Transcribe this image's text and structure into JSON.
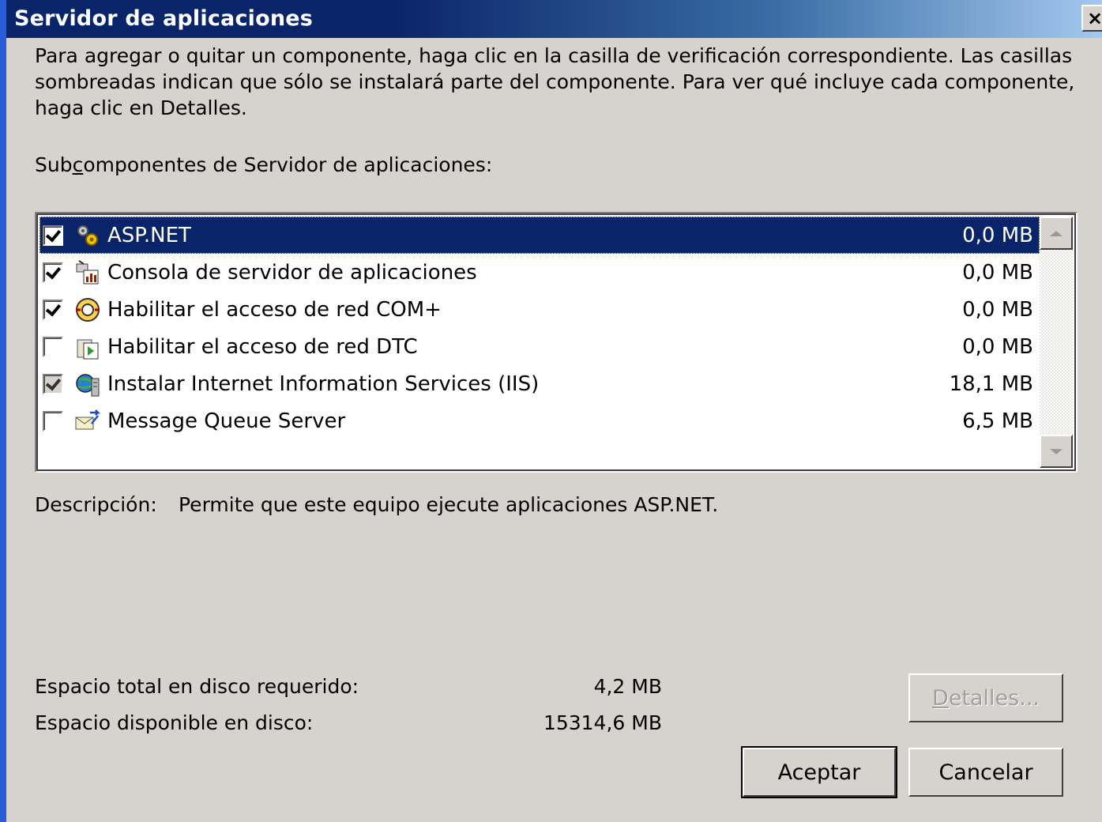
{
  "window": {
    "title": "Servidor de aplicaciones",
    "close_label": "×"
  },
  "intro_text": "Para agregar o quitar un componente, haga clic en la casilla de verificación correspondiente. Las casillas sombreadas indican que sólo se instalará parte del componente. Para ver qué incluye cada componente, haga clic en Detalles.",
  "subcomponents_label": {
    "before": "Sub",
    "accel": "c",
    "after": "omponentes de Servidor de aplicaciones:"
  },
  "components": [
    {
      "name": "ASP.NET",
      "size": "0,0 MB",
      "checked": true,
      "partial": false,
      "selected": true,
      "icon": "gears-icon"
    },
    {
      "name": "Consola de servidor de aplicaciones",
      "size": "0,0 MB",
      "checked": true,
      "partial": false,
      "selected": false,
      "icon": "console-icon"
    },
    {
      "name": "Habilitar el acceso de red COM+",
      "size": "0,0 MB",
      "checked": true,
      "partial": false,
      "selected": false,
      "icon": "com-network-icon"
    },
    {
      "name": "Habilitar el acceso de red DTC",
      "size": "0,0 MB",
      "checked": false,
      "partial": false,
      "selected": false,
      "icon": "dtc-icon"
    },
    {
      "name": "Instalar Internet Information Services (IIS)",
      "size": "18,1 MB",
      "checked": true,
      "partial": true,
      "selected": false,
      "icon": "iis-icon"
    },
    {
      "name": "Message Queue Server",
      "size": "6,5 MB",
      "checked": false,
      "partial": false,
      "selected": false,
      "icon": "message-queue-icon"
    }
  ],
  "description": {
    "label": "Descripción:",
    "value": "Permite que este equipo ejecute aplicaciones ASP.NET."
  },
  "disk": {
    "required_label": "Espacio total en disco requerido:",
    "required_value": "4,2 MB",
    "available_label": "Espacio disponible en disco:",
    "available_value": "15314,6 MB"
  },
  "buttons": {
    "details": {
      "accel": "D",
      "rest": "etalles..."
    },
    "accept": "Aceptar",
    "cancel": "Cancelar"
  }
}
